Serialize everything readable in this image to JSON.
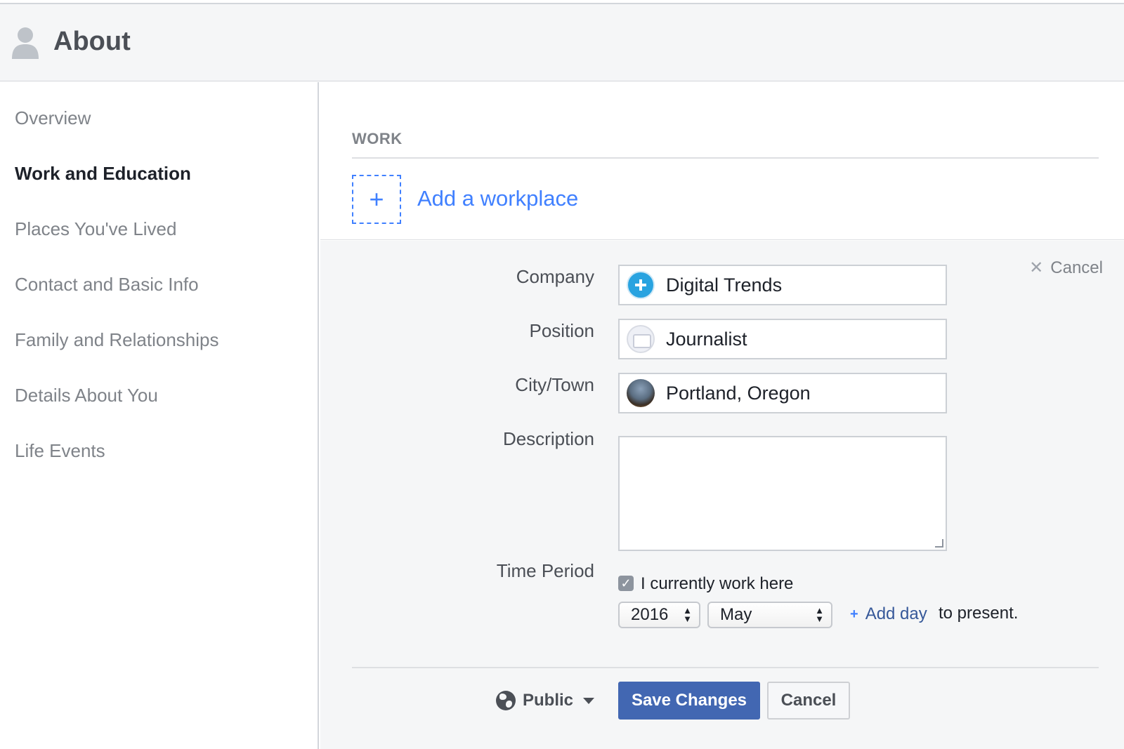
{
  "header": {
    "title": "About",
    "icon": "person-silhouette-icon"
  },
  "sidebar": {
    "items": [
      {
        "label": "Overview",
        "active": false
      },
      {
        "label": "Work and Education",
        "active": true
      },
      {
        "label": "Places You've Lived",
        "active": false
      },
      {
        "label": "Contact and Basic Info",
        "active": false
      },
      {
        "label": "Family and Relationships",
        "active": false
      },
      {
        "label": "Details About You",
        "active": false
      },
      {
        "label": "Life Events",
        "active": false
      }
    ]
  },
  "work": {
    "heading": "WORK",
    "add_icon": "+",
    "add_label": "Add a workplace"
  },
  "form": {
    "cancel_top": "Cancel",
    "company": {
      "label": "Company",
      "value": "Digital Trends"
    },
    "position": {
      "label": "Position",
      "value": "Journalist"
    },
    "city": {
      "label": "City/Town",
      "value": "Portland, Oregon"
    },
    "description": {
      "label": "Description",
      "value": ""
    },
    "time_period": {
      "label": "Time Period",
      "current_label": "I currently work here",
      "current_checked": true,
      "year": "2016",
      "month": "May",
      "add_day": "Add day",
      "to_present": "to present."
    },
    "audience": "Public",
    "save_label": "Save Changes",
    "cancel_label": "Cancel"
  },
  "colors": {
    "accent": "#4080ff",
    "primary_button": "#4267b2",
    "link": "#365899"
  }
}
